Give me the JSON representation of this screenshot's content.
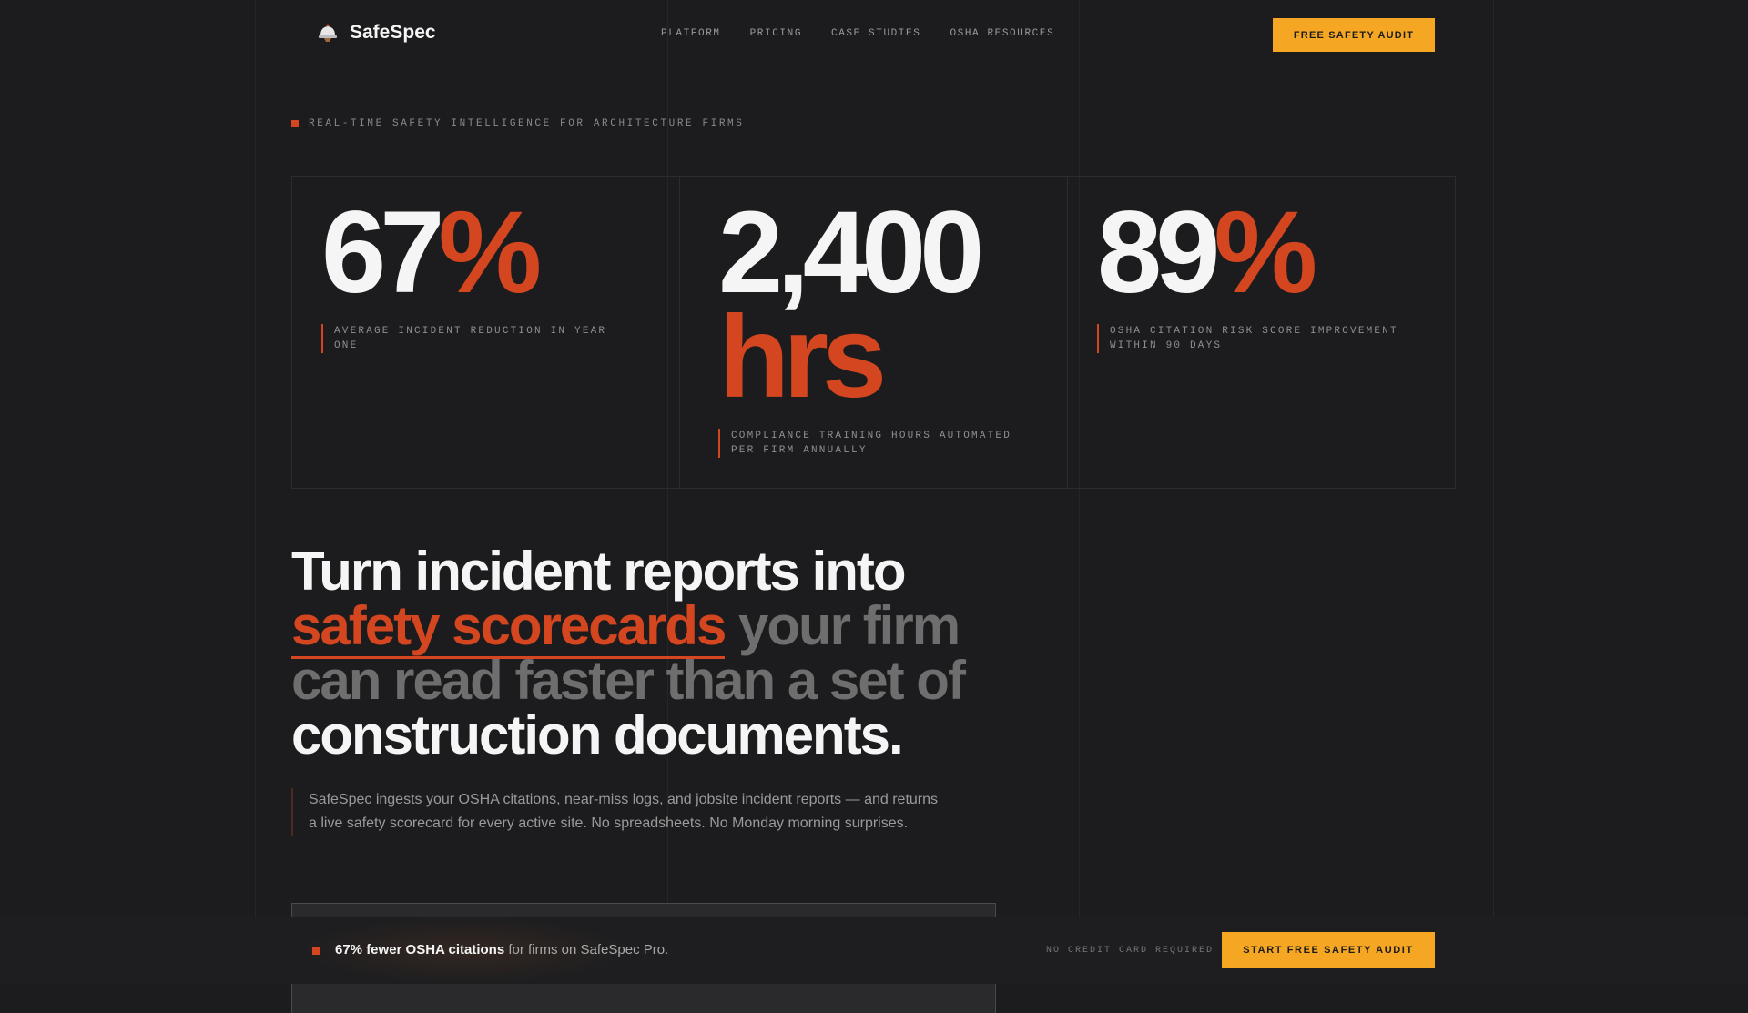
{
  "brand": {
    "name": "SafeSpec",
    "logo_icon": "hardhat-icon"
  },
  "nav": {
    "links": [
      "PLATFORM",
      "PRICING",
      "CASE STUDIES",
      "OSHA RESOURCES"
    ],
    "cta": "FREE SAFETY AUDIT"
  },
  "eyebrow": "REAL-TIME SAFETY INTELLIGENCE FOR ARCHITECTURE FIRMS",
  "stats": [
    {
      "value": "67",
      "unit": "%",
      "caption": "AVERAGE INCIDENT REDUCTION IN YEAR ONE"
    },
    {
      "value": "2,400",
      "unit": "hrs",
      "caption": "COMPLIANCE TRAINING HOURS AUTOMATED PER FIRM ANNUALLY"
    },
    {
      "value": "89",
      "unit": "%",
      "caption": "OSHA CITATION RISK SCORE IMPROVEMENT WITHIN 90 DAYS"
    }
  ],
  "headline": {
    "part1": "Turn incident reports into",
    "accent": "safety scorecards",
    "muted": "your firm can read faster than a set of",
    "part2": "construction documents."
  },
  "subcopy": "SafeSpec ingests your OSHA citations, near-miss logs, and jobsite incident reports — and returns a live safety scorecard for every active site. No spreadsheets. No Monday morning surprises.",
  "bottom_bar": {
    "bold": "67% fewer OSHA citations",
    "text": "for firms on SafeSpec Pro.",
    "note": "NO CREDIT CARD REQUIRED",
    "cta": "START FREE SAFETY AUDIT"
  },
  "colors": {
    "background": "#1c1c1e",
    "accent": "#d4461f",
    "cta": "#f5a623"
  }
}
